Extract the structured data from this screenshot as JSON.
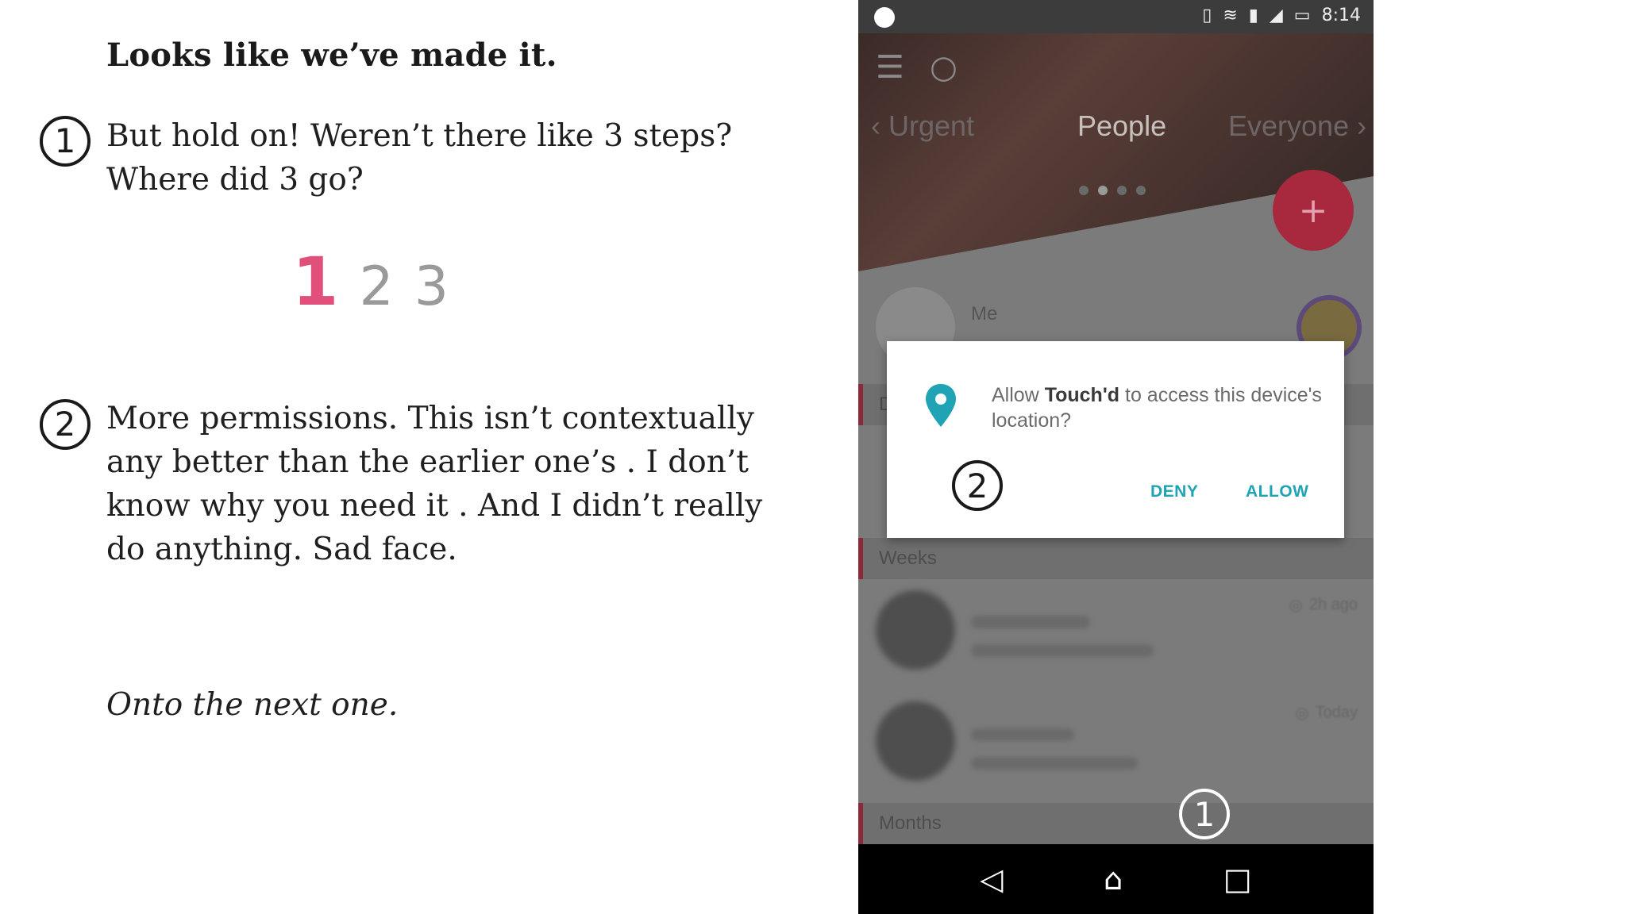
{
  "article": {
    "heading": "Looks like we’ve made it.",
    "marker1": "1",
    "para1": "But hold on! Weren’t there like 3 steps? Where did 3 go?",
    "steps": [
      "1",
      "2",
      "3"
    ],
    "marker2": "2",
    "para2": "More permissions. This isn’t contextually any better than the earlier one’s . I don’t know why you need it . And I didn’t really do anything. Sad face.",
    "closing": "Onto the next one."
  },
  "phone": {
    "status_time": "8:14",
    "tabs": [
      "Urgent",
      "People",
      "Everyone"
    ],
    "fab_label": "+",
    "me_label": "Me",
    "sections": [
      "D",
      "Weeks",
      "Months"
    ],
    "row_meta": [
      "2h ago",
      "Today"
    ],
    "overlay_marker": "1",
    "dialog": {
      "text_before": "Allow ",
      "app_name": "Touch'd",
      "text_after": " to access this device's location?",
      "marker": "2",
      "deny": "DENY",
      "allow": "ALLOW"
    },
    "colors": {
      "accent": "#1fa3b5",
      "fab": "#a8283e",
      "step_highlight": "#e0507a"
    }
  }
}
